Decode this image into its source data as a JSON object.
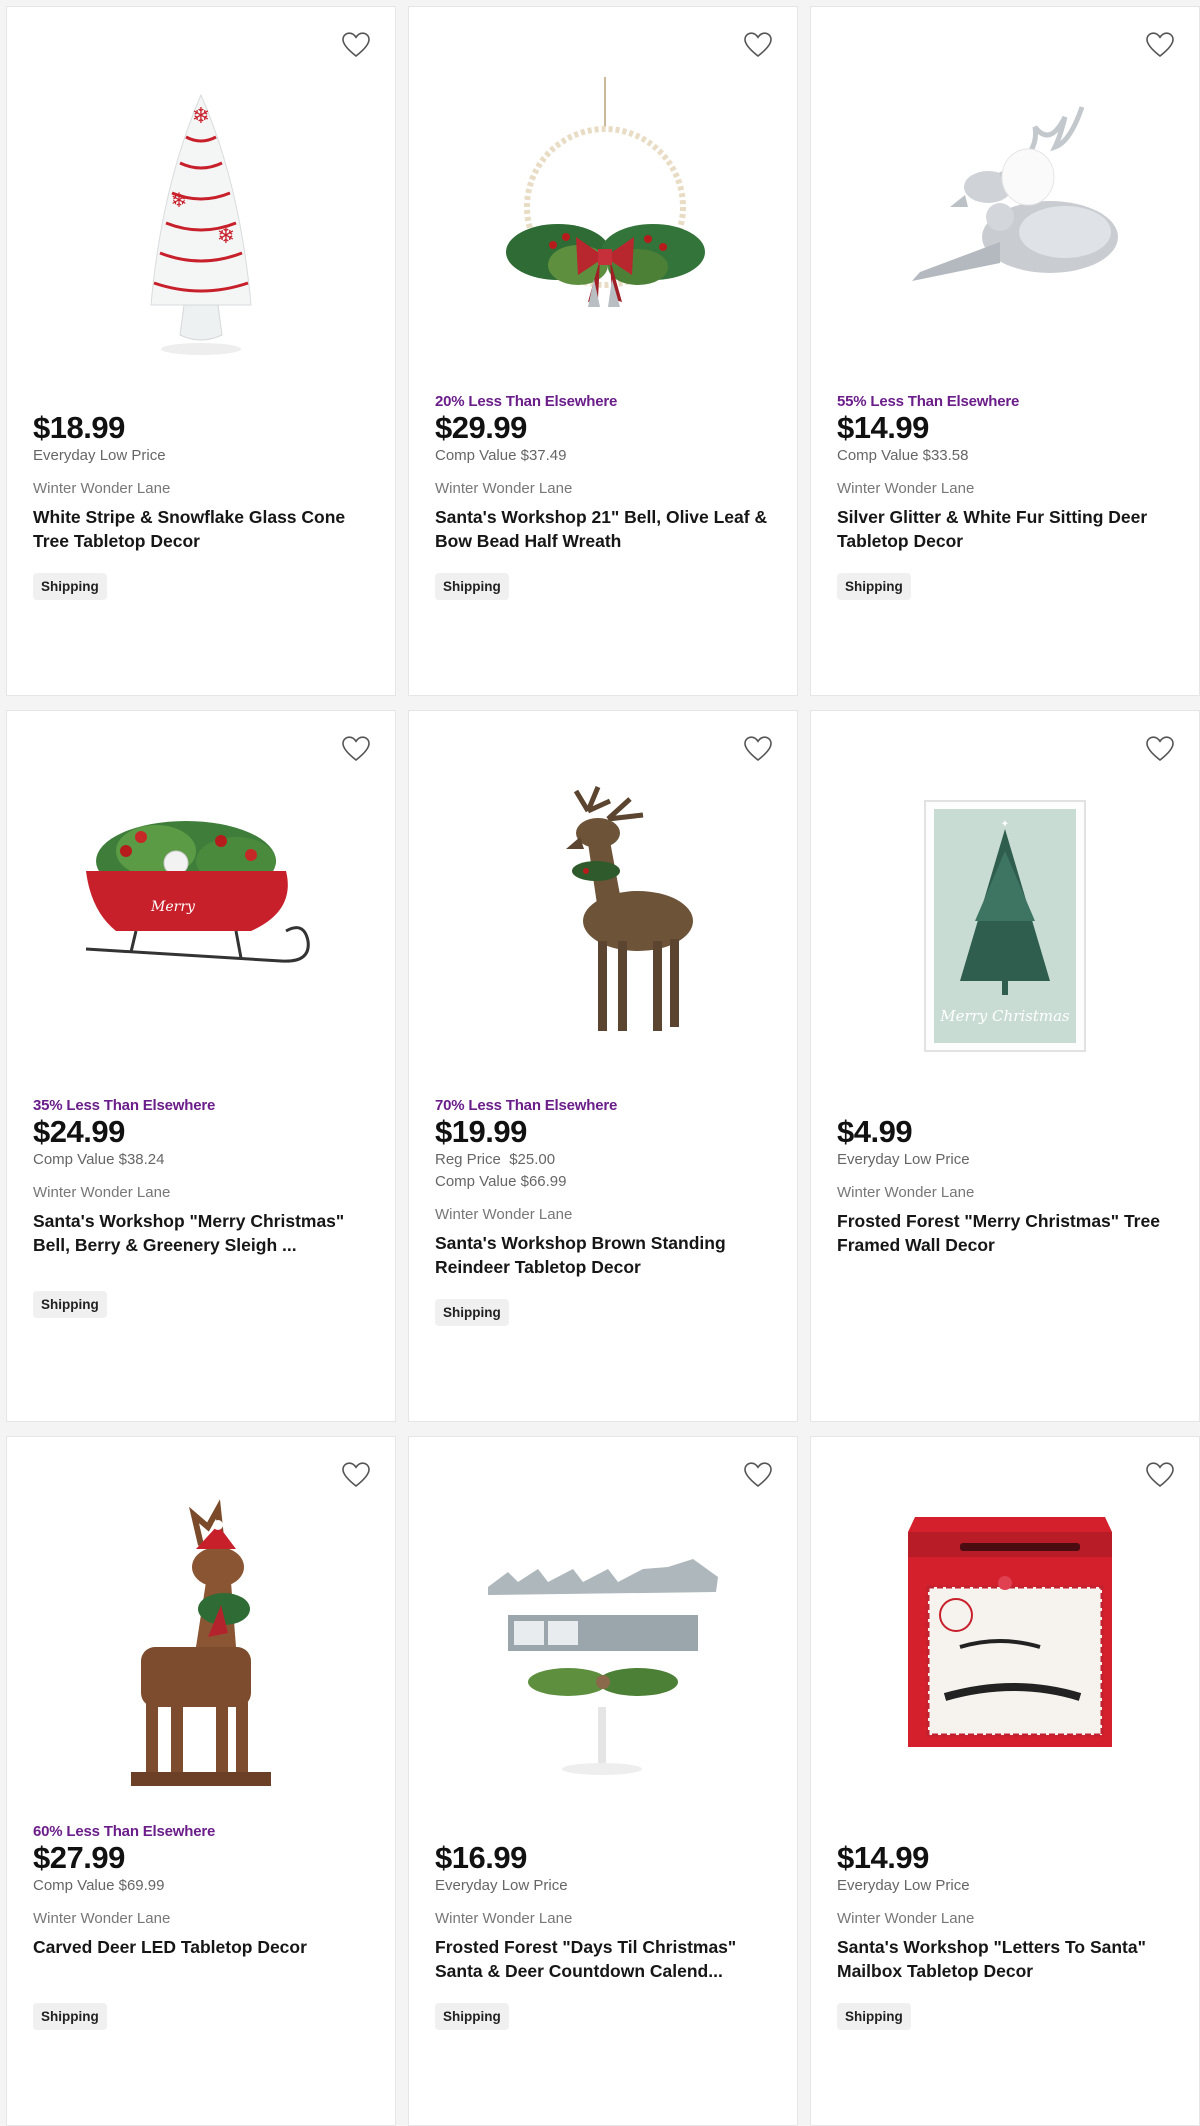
{
  "products": [
    {
      "savings": "",
      "price": "$18.99",
      "price_note": "Everyday Low Price",
      "reg_price_label": "",
      "reg_price_value": "",
      "brand": "Winter Wonder Lane",
      "title": "White Stripe & Snowflake Glass Cone Tree Tabletop Decor",
      "shipping": "Shipping",
      "image": "white-cone-tree"
    },
    {
      "savings": "20% Less Than Elsewhere",
      "price": "$29.99",
      "price_note": "Comp Value $37.49",
      "reg_price_label": "",
      "reg_price_value": "",
      "brand": "Winter Wonder Lane",
      "title": "Santa's Workshop 21\" Bell, Olive Leaf & Bow Bead Half Wreath",
      "shipping": "Shipping",
      "image": "bead-half-wreath"
    },
    {
      "savings": "55% Less Than Elsewhere",
      "price": "$14.99",
      "price_note": "Comp Value $33.58",
      "reg_price_label": "",
      "reg_price_value": "",
      "brand": "Winter Wonder Lane",
      "title": "Silver Glitter & White Fur Sitting Deer Tabletop Decor",
      "shipping": "Shipping",
      "image": "silver-sitting-deer"
    },
    {
      "savings": "35% Less Than Elsewhere",
      "price": "$24.99",
      "price_note": "Comp Value $38.24",
      "reg_price_label": "",
      "reg_price_value": "",
      "brand": "Winter Wonder Lane",
      "title": "Santa's Workshop \"Merry Christmas\" Bell, Berry & Greenery Sleigh ...",
      "shipping": "Shipping",
      "image": "red-sleigh"
    },
    {
      "savings": "70% Less Than Elsewhere",
      "price": "$19.99",
      "price_note": "Comp Value $66.99",
      "reg_price_label": "Reg Price",
      "reg_price_value": "$25.00",
      "brand": "Winter Wonder Lane",
      "title": "Santa's Workshop Brown Standing Reindeer Tabletop Decor",
      "shipping": "Shipping",
      "image": "standing-reindeer"
    },
    {
      "savings": "",
      "price": "$4.99",
      "price_note": "Everyday Low Price",
      "reg_price_label": "",
      "reg_price_value": "",
      "brand": "Winter Wonder Lane",
      "title": "Frosted Forest \"Merry Christmas\" Tree Framed Wall Decor",
      "shipping": "",
      "image": "framed-tree",
      "image_text": "Merry Christmas"
    },
    {
      "savings": "60% Less Than Elsewhere",
      "price": "$27.99",
      "price_note": "Comp Value $69.99",
      "reg_price_label": "",
      "reg_price_value": "",
      "brand": "Winter Wonder Lane",
      "title": "Carved Deer LED Tabletop Decor",
      "shipping": "Shipping",
      "image": "carved-wood-deer"
    },
    {
      "savings": "",
      "price": "$16.99",
      "price_note": "Everyday Low Price",
      "reg_price_label": "",
      "reg_price_value": "",
      "brand": "Winter Wonder Lane",
      "title": "Frosted Forest \"Days Til Christmas\" Santa & Deer Countdown Calend...",
      "shipping": "Shipping",
      "image": "countdown-calendar"
    },
    {
      "savings": "",
      "price": "$14.99",
      "price_note": "Everyday Low Price",
      "reg_price_label": "",
      "reg_price_value": "",
      "brand": "Winter Wonder Lane",
      "title": "Santa's Workshop \"Letters To Santa\" Mailbox Tabletop Decor",
      "shipping": "Shipping",
      "image": "santa-mailbox"
    }
  ],
  "colors": {
    "savings": "#6b1e8a",
    "price": "#111111",
    "muted": "#666666",
    "accent_red": "#c8202b"
  }
}
